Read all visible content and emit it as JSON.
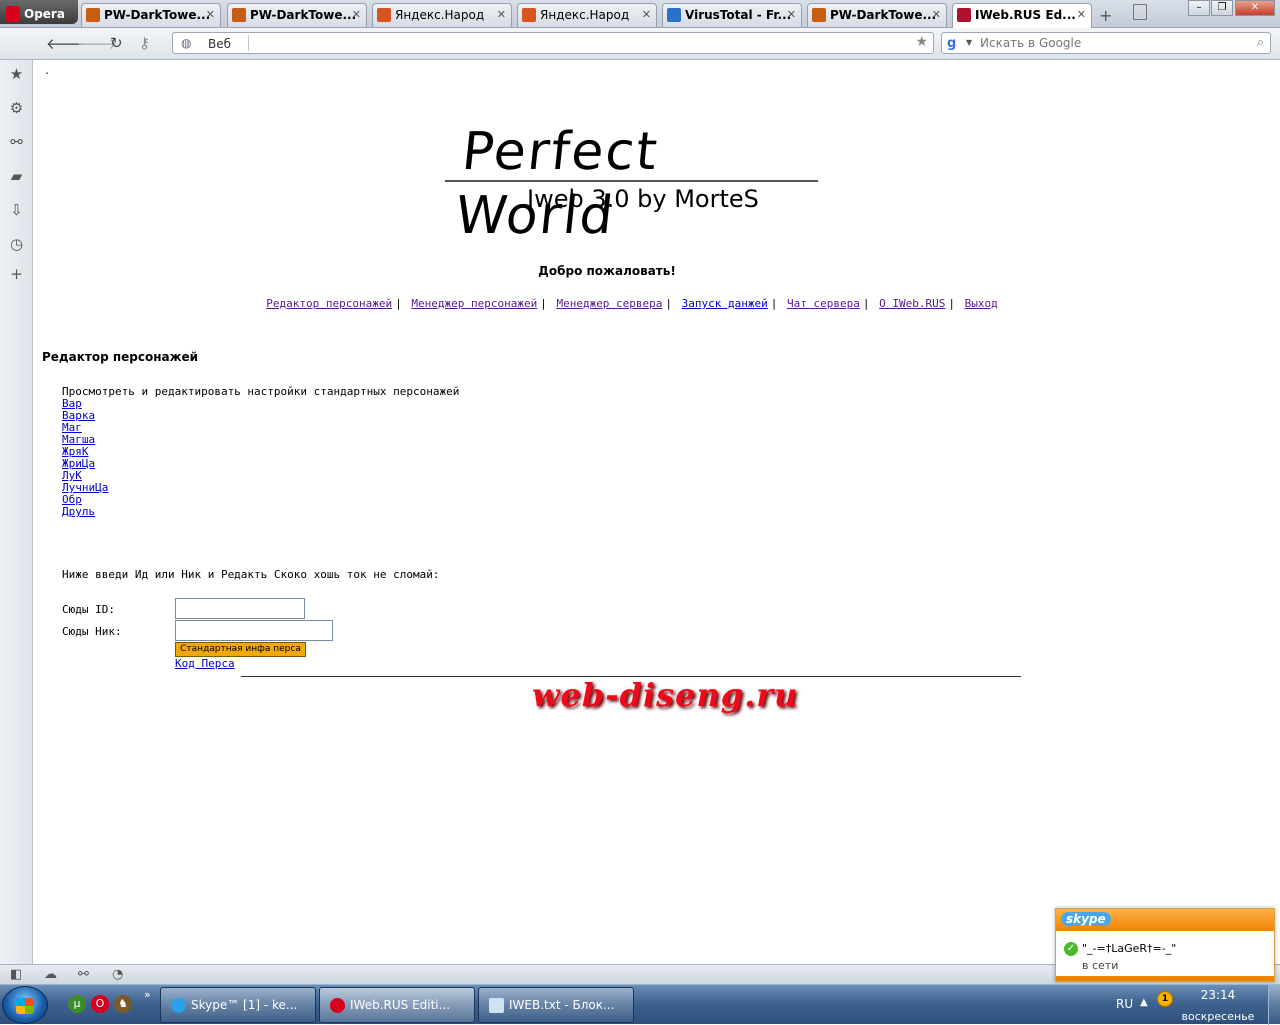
{
  "browser": {
    "menu_label": "Opera",
    "tabs": [
      {
        "title": "PW-DarkTowe...",
        "icon": "pw-favicon"
      },
      {
        "title": "PW-DarkTowe...",
        "icon": "pw-favicon"
      },
      {
        "title": "Яндекс.Народ",
        "icon": "yandex-favicon"
      },
      {
        "title": "Яндекс.Народ",
        "icon": "yandex-favicon"
      },
      {
        "title": "VirusTotal - Fr...",
        "icon": "virustotal-favicon"
      },
      {
        "title": "PW-DarkTowe...",
        "icon": "pw-favicon"
      },
      {
        "title": "IWeb.RUS Ed...",
        "icon": "iweb-favicon",
        "active": true
      }
    ],
    "address": {
      "label": "Веб",
      "value": ""
    },
    "search": {
      "placeholder": "Искать в Google"
    }
  },
  "page": {
    "dot": ".",
    "logo_title": "Perfect World",
    "logo_subtitle": "Iweb 3.0 by MorteS",
    "welcome": "Добро пожаловать!",
    "nav": [
      {
        "label": "Редактор персонажей",
        "visited": true
      },
      {
        "label": "Менеджер персонажей",
        "visited": true
      },
      {
        "label": "Менеджер сервера",
        "visited": true
      },
      {
        "label": "Запуск данжей",
        "visited": false
      },
      {
        "label": "Чат сервера",
        "visited": true
      },
      {
        "label": "О IWeb.RUS",
        "visited": true
      },
      {
        "label": "Выход",
        "visited": true
      }
    ],
    "nav_separator": "|",
    "section_title": "Редактор персонажей",
    "description": "Просмотреть и редактировать настройки стандартных персонажей",
    "classes": [
      "Вар",
      "Варка",
      "Маг",
      "Магша",
      "ЖряК",
      "ЖриЦа",
      "ЛуК",
      "ЛучниЦа",
      "Обр",
      "Друль"
    ],
    "hint": "Ниже введи Ид или Ник и Редакть Скоко хошь ток не сломай:",
    "form": {
      "id_label": "Сюды ID:",
      "id_value": "",
      "nick_label": "Сюды Ник:",
      "nick_value": "",
      "submit_label": "Стандартная инфа перса",
      "code_link": "Код Перса"
    },
    "watermark": "web-diseng.ru"
  },
  "taskbar": {
    "items": [
      {
        "label": "Skype™ [1] - ke...",
        "icon": "skype-icon"
      },
      {
        "label": "IWeb.RUS Editi...",
        "icon": "opera-icon",
        "active": true
      },
      {
        "label": "IWEB.txt - Блок...",
        "icon": "notepad-icon"
      }
    ],
    "language": "RU",
    "tray_badge": "1",
    "time": "23:14",
    "day": "воскресенье"
  },
  "skype_popup": {
    "logo": "skype",
    "user": "\"_-=†LaGeR†=-_\"",
    "status": "в сети"
  },
  "colors": {
    "link": "#0000cc",
    "visited": "#551a8b",
    "button": "#f1a90a",
    "watermark": "#ee0a1a",
    "skype_orange": "#f08400"
  }
}
